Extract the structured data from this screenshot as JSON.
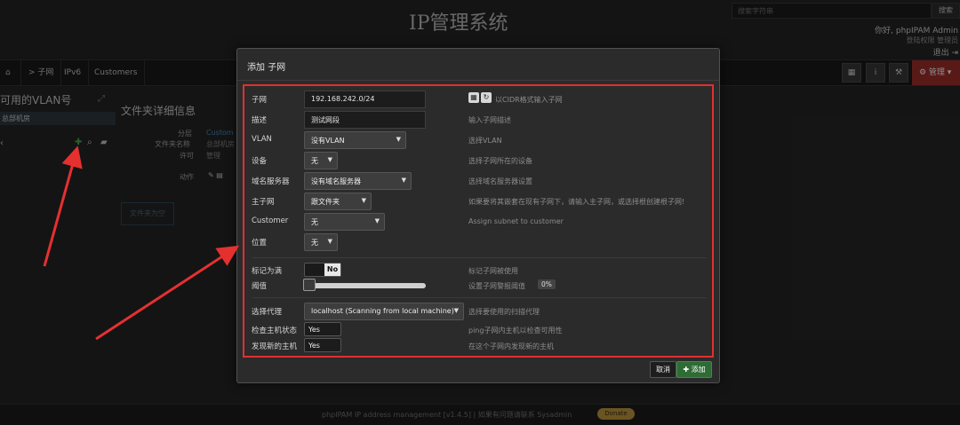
{
  "header": {
    "site_title": "IP管理系统",
    "search_placeholder": "搜索字符串",
    "search_button": "搜索",
    "greeting": "你好, phpIPAM Admin",
    "links": "登陆权限  管理员",
    "logout": "退出 ⇥"
  },
  "navbar": {
    "home_icon": "home-icon",
    "subnet_tab": "> 子网",
    "ipv6_tab": "IPv6",
    "customers_tab": "Customers",
    "admin_label": "⚙ 管理 ▾"
  },
  "left_panel": {
    "vlan_title": "可用的VLAN号",
    "hq": "总部机房"
  },
  "folder": {
    "title": "文件夹详细信息",
    "rows": [
      {
        "label": "分层",
        "value": "Custom"
      },
      {
        "label": "文件夹名称",
        "value": "总部机房"
      },
      {
        "label": "许可",
        "value": "管理"
      },
      {
        "label": "动作",
        "value": ""
      }
    ],
    "empty": "文件夹为空"
  },
  "footer": {
    "text": "phpIPAM IP address management [v1.4.5]  |  如果有问题请联系 Sysadmin",
    "donate": "Donate"
  },
  "modal": {
    "title": "添加 子网",
    "fields": {
      "subnet": {
        "label": "子网",
        "value": "192.168.242.0/24",
        "hint": "以CIDR格式输入子网"
      },
      "description": {
        "label": "描述",
        "value": "测试网段",
        "hint": "输入子网描述"
      },
      "vlan": {
        "label": "VLAN",
        "value": "没有VLAN",
        "hint": "选择VLAN"
      },
      "device": {
        "label": "设备",
        "value": "无",
        "hint": "选择子网所在的设备"
      },
      "dns": {
        "label": "域名服务器",
        "value": "没有域名服务器",
        "hint": "选择域名服务器设置"
      },
      "master": {
        "label": "主子网",
        "value": "跟文件夹",
        "hint": "如果要将其嵌套在现有子网下，请输入主子网，或选择根创建根子网!"
      },
      "customer": {
        "label": "Customer",
        "value": "无",
        "hint": "Assign subnet to customer"
      },
      "location": {
        "label": "位置",
        "value": "无",
        "hint": ""
      },
      "mark_full": {
        "label": "标记为满",
        "value": "No",
        "hint": "标记子网被使用"
      },
      "threshold": {
        "label": "阈值",
        "value": 0,
        "hint": "设置子网警报阈值",
        "badge": "0%"
      },
      "agent": {
        "label": "选择代理",
        "value": "localhost (Scanning from local machine)",
        "hint": "选择要使用的扫描代理"
      },
      "ping_check": {
        "label": "检查主机状态",
        "value": "Yes",
        "hint": "ping子网内主机以检查可用性"
      },
      "discover": {
        "label": "发现新的主机",
        "value": "Yes",
        "hint": "在这个子网内发现新的主机"
      }
    },
    "cancel": "取消",
    "add": "✚ 添加"
  },
  "colors": {
    "highlight_border": "#e03030",
    "add_button": "#2e6b35",
    "admin_nav": "#a3302a"
  }
}
